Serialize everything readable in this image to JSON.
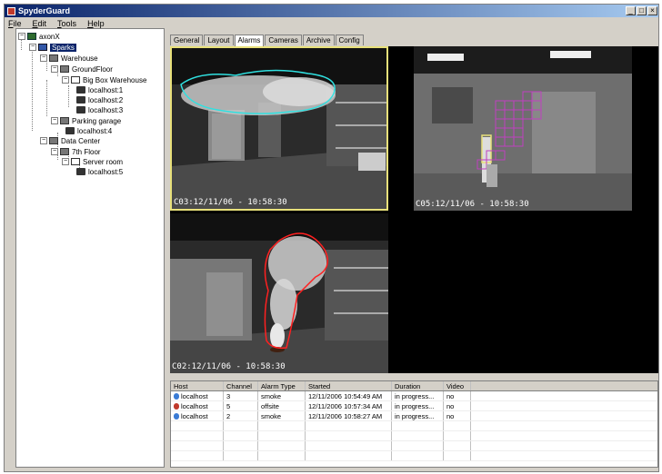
{
  "window": {
    "title": "SpyderGuard"
  },
  "menu": [
    "File",
    "Edit",
    "Tools",
    "Help"
  ],
  "tree": {
    "root": "axonX",
    "site": "Sparks",
    "warehouse": "Warehouse",
    "groundfloor": "GroundFloor",
    "bigbox": "Big Box Warehouse",
    "cam1": "localhost:1",
    "cam2": "localhost:2",
    "cam3": "localhost:3",
    "parking": "Parking garage",
    "cam4": "localhost:4",
    "datacenter": "Data Center",
    "floor7": "7th Floor",
    "serverroom": "Server room",
    "cam5": "localhost:5"
  },
  "tabs": [
    "General",
    "Layout",
    "Alarms",
    "Cameras",
    "Archive",
    "Config"
  ],
  "active_tab": "Alarms",
  "cameras": [
    {
      "timestamp": "C03:12/11/06 - 10:58:30"
    },
    {
      "timestamp": "C05:12/11/06 - 10:58:30"
    },
    {
      "timestamp": "C02:12/11/06 - 10:58:30"
    }
  ],
  "alarm_table": {
    "headers": [
      "Host",
      "Channel",
      "Alarm Type",
      "Started",
      "Duration",
      "Video"
    ],
    "rows": [
      {
        "host": "localhost",
        "channel": "3",
        "type": "smoke",
        "started": "12/11/2006 10:54:49 AM",
        "duration": "in progress...",
        "video": "no",
        "icon_color": "#3a7bd5"
      },
      {
        "host": "localhost",
        "channel": "5",
        "type": "offsite",
        "started": "12/11/2006 10:57:34 AM",
        "duration": "in progress...",
        "video": "no",
        "icon_color": "#c0392b"
      },
      {
        "host": "localhost",
        "channel": "2",
        "type": "smoke",
        "started": "12/11/2006 10:58:27 AM",
        "duration": "in progress...",
        "video": "no",
        "icon_color": "#3a7bd5"
      }
    ]
  },
  "colors": {
    "cam3_highlight": "#e8e07a",
    "smoke_cyan": "#30e0e0",
    "intrusion_magenta": "#c040c0",
    "smoke_red": "#ff2020"
  }
}
